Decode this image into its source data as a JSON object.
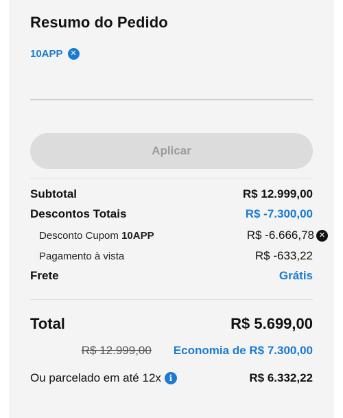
{
  "summary": {
    "title": "Resumo do Pedido",
    "coupon": {
      "code": "10APP"
    },
    "coupon_input": {
      "value": "",
      "placeholder": ""
    },
    "apply_button": "Aplicar",
    "lines": {
      "subtotal": {
        "label": "Subtotal",
        "value": "R$ 12.999,00"
      },
      "total_discounts": {
        "label": "Descontos Totais",
        "value": "R$ -7.300,00"
      },
      "coupon_discount": {
        "label_prefix": "Desconto Cupom ",
        "code": "10APP",
        "value": "R$ -6.666,78"
      },
      "cash_payment": {
        "label": "Pagamento à vista",
        "value": "R$ -633,22"
      },
      "shipping": {
        "label": "Frete",
        "value": "Grátis"
      }
    },
    "total": {
      "label": "Total",
      "value": "R$ 5.699,00",
      "original_price": "R$ 12.999,00",
      "savings": "Economia de R$ 7.300,00"
    },
    "installment": {
      "label": "Ou parcelado em até 12x",
      "value": "R$ 6.332,22"
    }
  },
  "colors": {
    "accent": "#1a7bd1",
    "card_background": "#f4f4f4",
    "button_disabled": "#dcdcdc"
  }
}
